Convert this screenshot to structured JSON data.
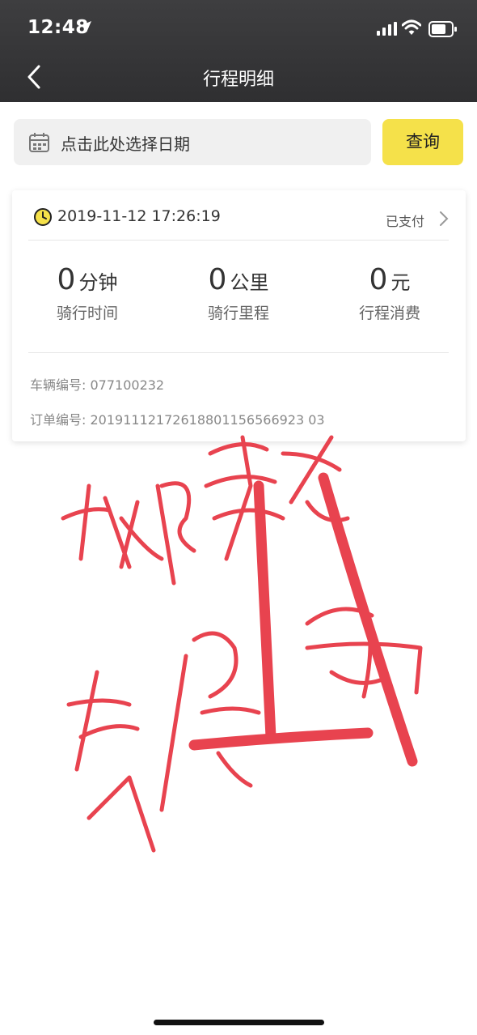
{
  "status_bar": {
    "time": "12:48"
  },
  "nav": {
    "title": "行程明细"
  },
  "search": {
    "date_placeholder": "点击此处选择日期",
    "query_label": "查询"
  },
  "trip": {
    "datetime": "2019-11-12 17:26:19",
    "pay_status": "已支付",
    "stats": [
      {
        "value": "0",
        "unit": "分钟",
        "label": "骑行时间"
      },
      {
        "value": "0",
        "unit": "公里",
        "label": "骑行里程"
      },
      {
        "value": "0",
        "unit": "元",
        "label": "行程消费"
      }
    ],
    "vehicle_label": "车辆编号: ",
    "vehicle_no": "077100232",
    "order_label": "订单编号: ",
    "order_no": "20191112172618801156566923 03"
  },
  "colors": {
    "header_bg": "#333335",
    "accent": "#f5e14a",
    "scribble": "#e8434f"
  }
}
